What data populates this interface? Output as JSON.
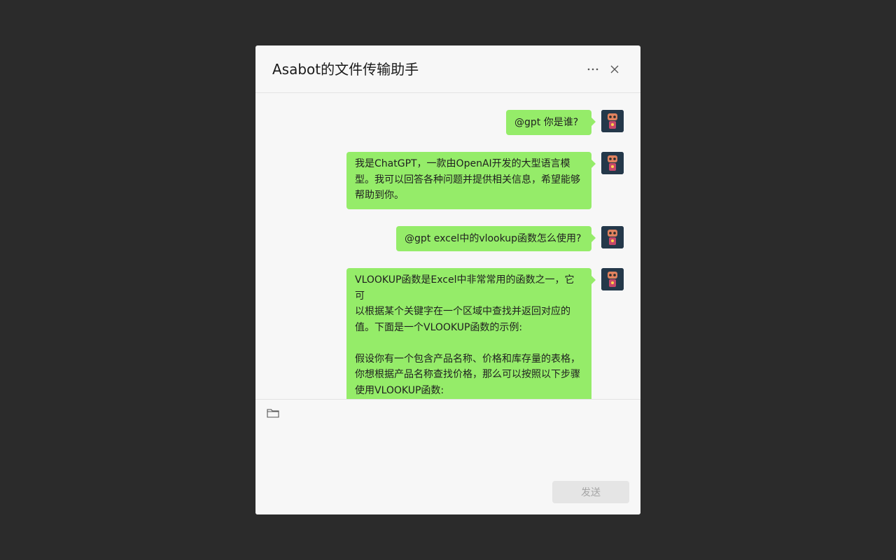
{
  "window": {
    "title": "Asabot的文件传输助手"
  },
  "header": {
    "more_icon": "more-horizontal-icon",
    "close_icon": "close-icon"
  },
  "messages": [
    {
      "sender": "self",
      "text": "@gpt 你是谁?"
    },
    {
      "sender": "self",
      "text": "我是ChatGPT，一款由OpenAI开发的大型语言模\n型。我可以回答各种问题并提供相关信息，希望能够\n帮助到你。"
    },
    {
      "sender": "self",
      "text": "@gpt excel中的vlookup函数怎么使用?"
    },
    {
      "sender": "self",
      "text": "VLOOKUP函数是Excel中非常常用的函数之一，它可\n以根据某个关键字在一个区域中查找并返回对应的\n值。下面是一个VLOOKUP函数的示例:\n\n假设你有一个包含产品名称、价格和库存量的表格，\n你想根据产品名称查找价格，那么可以按照以下步骤\n使用VLOOKUP函数:\n\n"
    }
  ],
  "composer": {
    "folder_icon": "folder-icon",
    "input_value": "",
    "send_label": "发送"
  },
  "colors": {
    "backdrop": "#2b2b2b",
    "dialog_bg": "#f7f7f7",
    "bubble": "#95ec69",
    "send_disabled_bg": "#e5e5e5",
    "send_disabled_text": "#a5a5a5"
  }
}
